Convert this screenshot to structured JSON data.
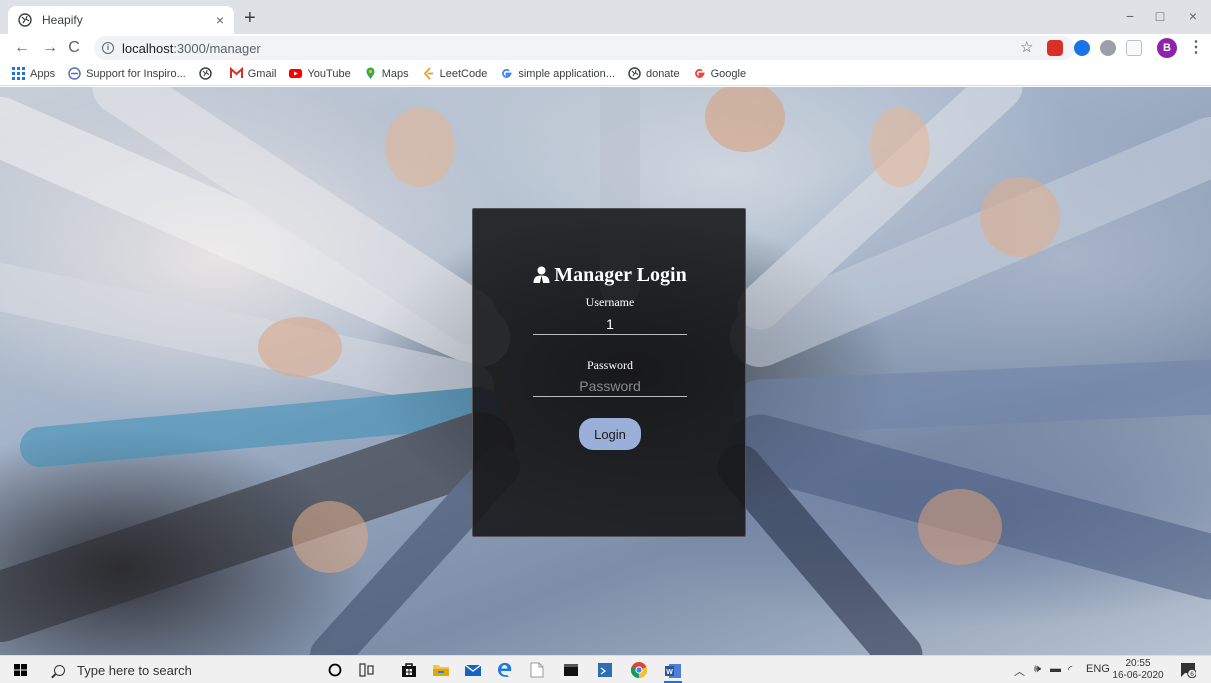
{
  "browser": {
    "tab_title": "Heapify",
    "tab_close": "×",
    "new_tab": "+",
    "window": {
      "minimize": "−",
      "maximize": "□",
      "close": "×"
    },
    "nav": {
      "back": "←",
      "forward": "→",
      "reload": "C"
    },
    "url_host": "localhost",
    "url_rest": ":3000/manager",
    "bookmark_star": "☆",
    "profile_initial": "B",
    "menu": "⋮"
  },
  "bookmarks": [
    {
      "label": "Apps",
      "icon": "apps-grid-icon"
    },
    {
      "label": "Support for Inspiro...",
      "icon": "support-icon"
    },
    {
      "label": "",
      "icon": "globe-icon"
    },
    {
      "label": "Gmail",
      "icon": "gmail-icon"
    },
    {
      "label": "YouTube",
      "icon": "youtube-icon"
    },
    {
      "label": "Maps",
      "icon": "maps-pin-icon"
    },
    {
      "label": "LeetCode",
      "icon": "leetcode-icon"
    },
    {
      "label": "simple application...",
      "icon": "google-icon"
    },
    {
      "label": "donate",
      "icon": "globe-icon"
    },
    {
      "label": "Google",
      "icon": "google-icon"
    }
  ],
  "login": {
    "title": "Manager Login",
    "username_label": "Username",
    "username_value": "1",
    "password_label": "Password",
    "password_placeholder": "Password",
    "button_label": "Login"
  },
  "taskbar": {
    "search_placeholder": "Type here to search",
    "tray_lang": "ENG",
    "time": "20:55",
    "date": "16-06-2020",
    "notification_count": "6"
  },
  "colors": {
    "card_bg": "#141416",
    "button_bg": "#9bb0d9",
    "profile_bg": "#8e24aa"
  }
}
